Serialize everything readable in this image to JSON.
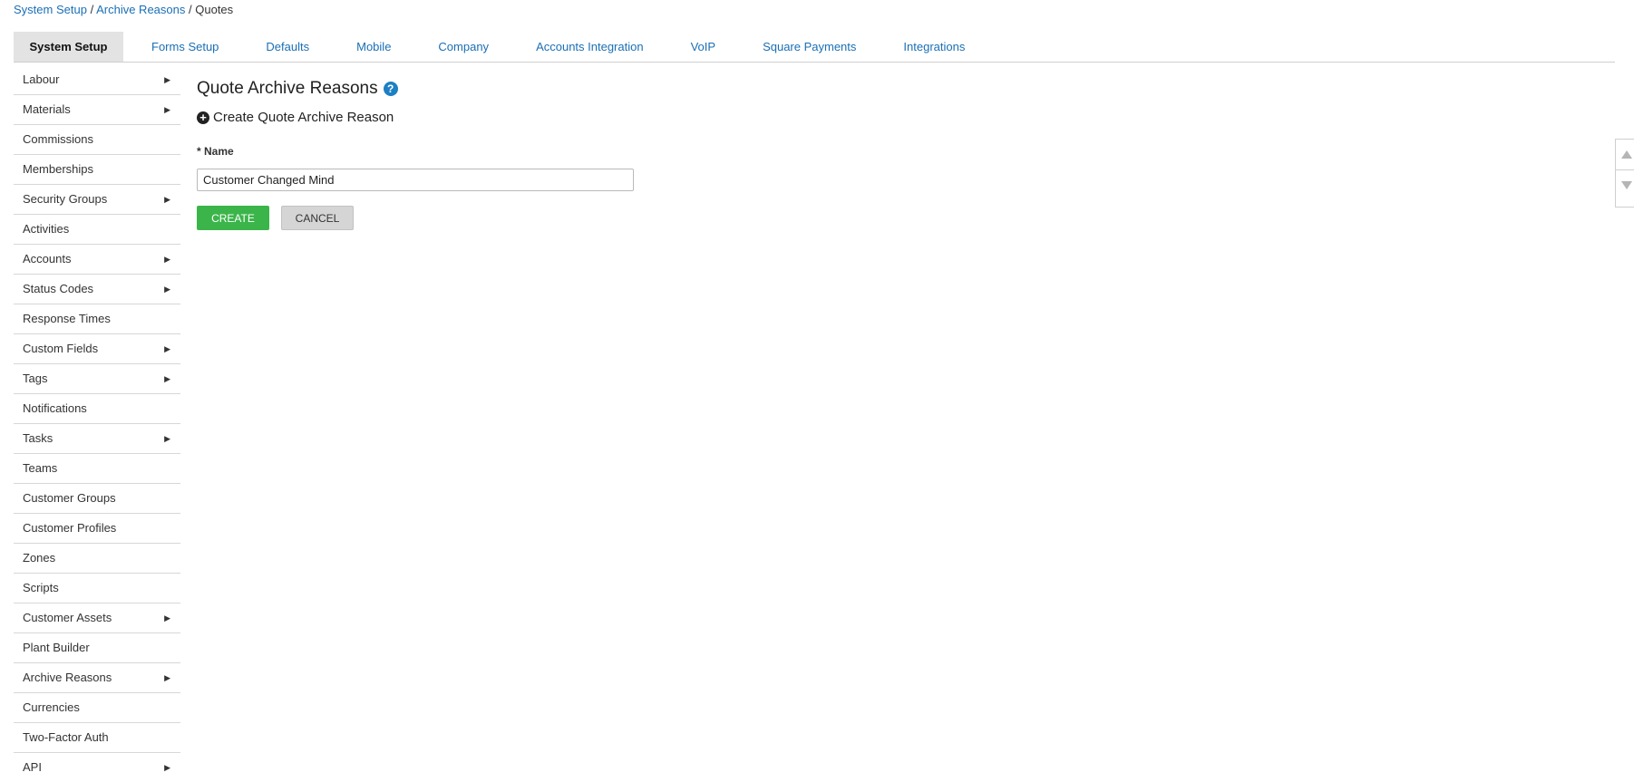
{
  "breadcrumb": {
    "items": [
      "System Setup",
      "Archive Reasons"
    ],
    "separator": "/",
    "current": "Quotes"
  },
  "tabs": [
    {
      "label": "System Setup",
      "active": true
    },
    {
      "label": "Forms Setup"
    },
    {
      "label": "Defaults"
    },
    {
      "label": "Mobile"
    },
    {
      "label": "Company"
    },
    {
      "label": "Accounts Integration"
    },
    {
      "label": "VoIP"
    },
    {
      "label": "Square Payments"
    },
    {
      "label": "Integrations"
    }
  ],
  "sidebar": {
    "items": [
      {
        "label": "Labour",
        "has_submenu": true
      },
      {
        "label": "Materials",
        "has_submenu": true
      },
      {
        "label": "Commissions",
        "has_submenu": false
      },
      {
        "label": "Memberships",
        "has_submenu": false
      },
      {
        "label": "Security Groups",
        "has_submenu": true
      },
      {
        "label": "Activities",
        "has_submenu": false
      },
      {
        "label": "Accounts",
        "has_submenu": true
      },
      {
        "label": "Status Codes",
        "has_submenu": true
      },
      {
        "label": "Response Times",
        "has_submenu": false
      },
      {
        "label": "Custom Fields",
        "has_submenu": true
      },
      {
        "label": "Tags",
        "has_submenu": true
      },
      {
        "label": "Notifications",
        "has_submenu": false
      },
      {
        "label": "Tasks",
        "has_submenu": true
      },
      {
        "label": "Teams",
        "has_submenu": false
      },
      {
        "label": "Customer Groups",
        "has_submenu": false
      },
      {
        "label": "Customer Profiles",
        "has_submenu": false
      },
      {
        "label": "Zones",
        "has_submenu": false
      },
      {
        "label": "Scripts",
        "has_submenu": false
      },
      {
        "label": "Customer Assets",
        "has_submenu": true
      },
      {
        "label": "Plant Builder",
        "has_submenu": false
      },
      {
        "label": "Archive Reasons",
        "has_submenu": true
      },
      {
        "label": "Currencies",
        "has_submenu": false
      },
      {
        "label": "Two-Factor Auth",
        "has_submenu": false
      },
      {
        "label": "API",
        "has_submenu": true
      }
    ],
    "arrow_glyph": "▶"
  },
  "main": {
    "title": "Quote Archive Reasons",
    "help_glyph": "?",
    "create_link": "Create Quote Archive Reason",
    "plus_glyph": "+",
    "form": {
      "required_mark": "*",
      "name_label": "Name",
      "name_value": "Customer Changed Mind",
      "create_label": "CREATE",
      "cancel_label": "CANCEL"
    }
  },
  "colors": {
    "link": "#1a6fb5",
    "create_button": "#3bb54a",
    "cancel_button": "#d5d5d5",
    "active_tab": "#e3e3e3",
    "help_icon": "#1d7fc4"
  },
  "icons": {
    "help": "question-circle-icon",
    "create": "plus-circle-icon",
    "submenu": "caret-right-icon",
    "scroll_up": "triangle-up-icon",
    "scroll_down": "triangle-down-icon"
  }
}
